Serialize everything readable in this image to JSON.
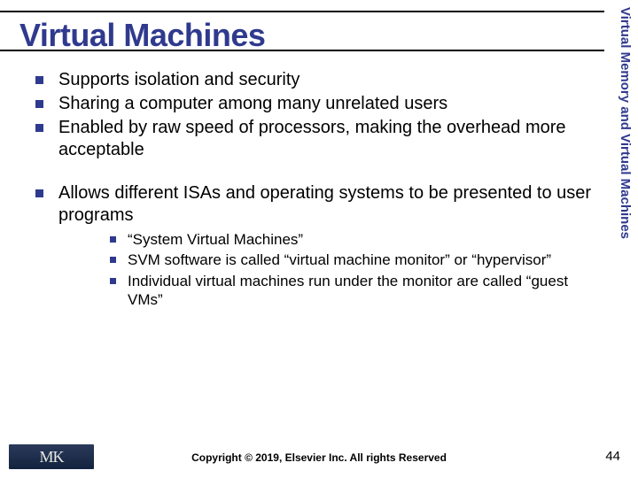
{
  "title": "Virtual Machines",
  "sidebar_label": "Virtual Memory and Virtual Machines",
  "bullets_group1": [
    "Supports isolation and security",
    "Sharing a computer among many unrelated users",
    "Enabled by raw speed of processors, making the overhead more acceptable"
  ],
  "bullets_group2": [
    "Allows different ISAs and operating systems to be presented to user programs"
  ],
  "sub_bullets": [
    "“System Virtual Machines”",
    "SVM software is called “virtual machine monitor” or “hypervisor”",
    "Individual virtual machines run under the monitor are called “guest VMs”"
  ],
  "logo_text": "MK",
  "copyright": "Copyright © 2019, Elsevier Inc. All rights Reserved",
  "page_number": "44"
}
